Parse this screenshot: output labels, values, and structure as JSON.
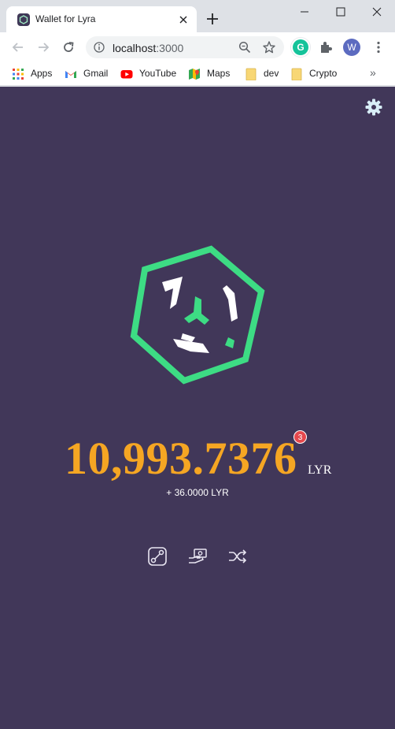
{
  "browser": {
    "tab": {
      "title": "Wallet for Lyra",
      "favicon": "lyra-favicon"
    },
    "address_bar": {
      "host": "localhost",
      "port": ":3000"
    },
    "profile_initial": "W",
    "extension_badge": "G",
    "bookmarks": [
      {
        "label": "Apps",
        "icon": "apps-grid-icon"
      },
      {
        "label": "Gmail",
        "icon": "gmail-icon"
      },
      {
        "label": "YouTube",
        "icon": "youtube-icon"
      },
      {
        "label": "Maps",
        "icon": "maps-icon"
      },
      {
        "label": "dev",
        "icon": "folder-icon"
      },
      {
        "label": "Crypto",
        "icon": "folder-icon"
      }
    ],
    "bookmarks_overflow": "»"
  },
  "wallet": {
    "balance": "10,993.7376",
    "unit": "LYR",
    "notification_count": "3",
    "pending_change": "+ 36.0000 LYR",
    "actions": [
      "send-receive-icon",
      "payment-icon",
      "swap-icon"
    ]
  },
  "colors": {
    "page_bg": "#413759",
    "balance": "#f5a623",
    "logo_green": "#3ddc84",
    "badge": "#e5484d"
  }
}
